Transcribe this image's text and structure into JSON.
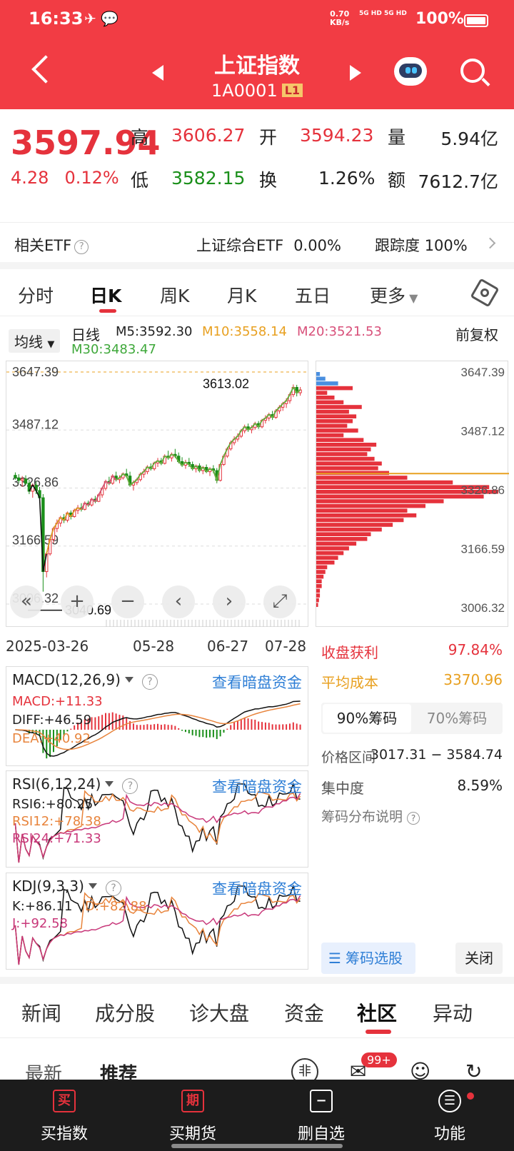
{
  "status_bar": {
    "time": "16:33",
    "net_speed": "0.70",
    "net_unit": "KB/s",
    "signal1": "5G HD",
    "signal2": "5G HD",
    "battery": "100%"
  },
  "header": {
    "title": "上证指数",
    "code": "1A0001",
    "level_badge": "L1"
  },
  "quote": {
    "price": "3597.94",
    "change": "4.28",
    "change_pct": "0.12%",
    "high_label": "高",
    "high": "3606.27",
    "open_label": "开",
    "open": "3594.23",
    "volume_label": "量",
    "volume": "5.94亿",
    "low_label": "低",
    "low": "3582.15",
    "turnover_label": "换",
    "turnover": "1.26%",
    "amount_label": "额",
    "amount": "7612.7亿"
  },
  "etf": {
    "label": "相关ETF",
    "name": "上证综合ETF",
    "change": "0.00%",
    "tracking_label": "跟踪度",
    "tracking": "100%"
  },
  "chart_tabs": [
    "分时",
    "日K",
    "周K",
    "月K",
    "五日",
    "更多"
  ],
  "active_chart_tab": "日K",
  "ma_bar": {
    "selector": "均线",
    "type": "日线",
    "ma5": "M5:3592.30",
    "ma10": "M10:3558.14",
    "ma20": "M20:3521.53",
    "ma30": "M30:3483.47",
    "adjust": "前复权"
  },
  "colors": {
    "brand": "#f23c44",
    "up": "#e5323c",
    "down": "#1a8f1a",
    "ma5": "#111111",
    "ma10": "#e8a020",
    "ma20": "#d8507a",
    "ma30": "#5cb83c",
    "link": "#2f7fd6"
  },
  "kline": {
    "y_ticks": [
      "3647.39",
      "3487.12",
      "3326.86",
      "3166.59",
      "3006.32"
    ],
    "max_label": "3613.02",
    "min_label": "3040.69",
    "dates": [
      "2025-03-26",
      "05-28",
      "06-27",
      "07-28"
    ]
  },
  "chart_data": {
    "type": "candlestick",
    "ylim": [
      3006.32,
      3647.39
    ],
    "y_ticks": [
      3647.39,
      3487.12,
      3326.86,
      3166.59,
      3006.32
    ],
    "x_labels": [
      "2025-03-26",
      "05-28",
      "06-27",
      "07-28"
    ],
    "ohlc": [
      [
        3362,
        3370,
        3350,
        3355
      ],
      [
        3355,
        3365,
        3340,
        3348
      ],
      [
        3348,
        3360,
        3330,
        3352
      ],
      [
        3352,
        3362,
        3335,
        3340
      ],
      [
        3340,
        3350,
        3310,
        3318
      ],
      [
        3318,
        3340,
        3300,
        3335
      ],
      [
        3335,
        3345,
        3310,
        3320
      ],
      [
        3320,
        3330,
        3290,
        3300
      ],
      [
        3300,
        3310,
        3040.69,
        3096
      ],
      [
        3096,
        3150,
        3080,
        3145
      ],
      [
        3145,
        3190,
        3140,
        3185
      ],
      [
        3185,
        3220,
        3175,
        3215
      ],
      [
        3215,
        3240,
        3205,
        3230
      ],
      [
        3230,
        3250,
        3220,
        3245
      ],
      [
        3245,
        3255,
        3230,
        3238
      ],
      [
        3238,
        3262,
        3232,
        3258
      ],
      [
        3258,
        3265,
        3240,
        3248
      ],
      [
        3248,
        3270,
        3245,
        3265
      ],
      [
        3265,
        3280,
        3255,
        3272
      ],
      [
        3272,
        3285,
        3262,
        3268
      ],
      [
        3268,
        3290,
        3265,
        3285
      ],
      [
        3285,
        3292,
        3275,
        3280
      ],
      [
        3280,
        3300,
        3276,
        3296
      ],
      [
        3296,
        3305,
        3285,
        3290
      ],
      [
        3290,
        3312,
        3288,
        3308
      ],
      [
        3308,
        3330,
        3300,
        3326
      ],
      [
        3326,
        3350,
        3320,
        3345
      ],
      [
        3345,
        3358,
        3335,
        3340
      ],
      [
        3340,
        3365,
        3336,
        3360
      ],
      [
        3360,
        3372,
        3345,
        3350
      ],
      [
        3350,
        3362,
        3340,
        3355
      ],
      [
        3355,
        3370,
        3350,
        3366
      ],
      [
        3366,
        3380,
        3355,
        3360
      ],
      [
        3360,
        3372,
        3330,
        3335
      ],
      [
        3335,
        3348,
        3320,
        3342
      ],
      [
        3342,
        3355,
        3335,
        3350
      ],
      [
        3350,
        3370,
        3345,
        3365
      ],
      [
        3365,
        3380,
        3355,
        3372
      ],
      [
        3372,
        3390,
        3365,
        3385
      ],
      [
        3385,
        3395,
        3375,
        3380
      ],
      [
        3380,
        3400,
        3375,
        3396
      ],
      [
        3396,
        3410,
        3385,
        3402
      ],
      [
        3402,
        3410,
        3390,
        3395
      ],
      [
        3395,
        3420,
        3392,
        3415
      ],
      [
        3415,
        3430,
        3405,
        3410
      ],
      [
        3410,
        3425,
        3400,
        3420
      ],
      [
        3420,
        3435,
        3410,
        3415
      ],
      [
        3415,
        3425,
        3395,
        3400
      ],
      [
        3400,
        3412,
        3385,
        3390
      ],
      [
        3390,
        3405,
        3380,
        3398
      ],
      [
        3398,
        3410,
        3385,
        3392
      ],
      [
        3392,
        3400,
        3375,
        3380
      ],
      [
        3380,
        3392,
        3370,
        3388
      ],
      [
        3388,
        3395,
        3370,
        3375
      ],
      [
        3375,
        3388,
        3365,
        3384
      ],
      [
        3384,
        3392,
        3368,
        3372
      ],
      [
        3372,
        3385,
        3360,
        3380
      ],
      [
        3380,
        3390,
        3368,
        3375
      ],
      [
        3375,
        3382,
        3340,
        3348
      ],
      [
        3348,
        3395,
        3345,
        3392
      ],
      [
        3392,
        3420,
        3388,
        3415
      ],
      [
        3415,
        3440,
        3410,
        3435
      ],
      [
        3435,
        3458,
        3430,
        3452
      ],
      [
        3452,
        3470,
        3445,
        3462
      ],
      [
        3462,
        3478,
        3455,
        3470
      ],
      [
        3470,
        3490,
        3465,
        3485
      ],
      [
        3485,
        3502,
        3478,
        3496
      ],
      [
        3496,
        3505,
        3482,
        3488
      ],
      [
        3488,
        3500,
        3478,
        3494
      ],
      [
        3494,
        3510,
        3488,
        3505
      ],
      [
        3505,
        3512,
        3490,
        3496
      ],
      [
        3496,
        3518,
        3492,
        3514
      ],
      [
        3514,
        3528,
        3505,
        3520
      ],
      [
        3520,
        3535,
        3512,
        3530
      ],
      [
        3530,
        3540,
        3515,
        3522
      ],
      [
        3522,
        3545,
        3518,
        3540
      ],
      [
        3540,
        3556,
        3532,
        3550
      ],
      [
        3550,
        3565,
        3540,
        3560
      ],
      [
        3560,
        3575,
        3548,
        3568
      ],
      [
        3568,
        3590,
        3560,
        3585
      ],
      [
        3585,
        3613.02,
        3578,
        3605
      ],
      [
        3605,
        3612,
        3580,
        3590
      ],
      [
        3590,
        3606,
        3582,
        3598
      ]
    ]
  },
  "volume_profile": {
    "y_ticks": [
      "3647.39",
      "3487.12",
      "3326.86",
      "3166.59",
      "3006.32"
    ],
    "bars": [
      0.02,
      0.05,
      0.12,
      0.2,
      0.06,
      0.1,
      0.15,
      0.25,
      0.18,
      0.22,
      0.2,
      0.17,
      0.23,
      0.15,
      0.26,
      0.33,
      0.3,
      0.28,
      0.32,
      0.36,
      0.34,
      0.4,
      0.5,
      0.75,
      0.95,
      1.0,
      0.92,
      0.7,
      0.6,
      0.5,
      0.55,
      0.48,
      0.42,
      0.36,
      0.3,
      0.28,
      0.22,
      0.18,
      0.15,
      0.12,
      0.1,
      0.06,
      0.05,
      0.04,
      0.03,
      0.03,
      0.02,
      0.02,
      0.015,
      0.01
    ]
  },
  "controls": {
    "first": "«",
    "zoom_in": "+",
    "zoom_out": "−",
    "prev": "‹",
    "next": "›",
    "fullscreen": "⤢"
  },
  "macd": {
    "name": "MACD(12,26,9)",
    "link": "查看暗盘资金",
    "macd": "MACD:+11.33",
    "diff": "DIFF:+46.59",
    "dea": "DEA:+40.92"
  },
  "rsi": {
    "name": "RSI(6,12,24)",
    "link": "查看暗盘资金",
    "rsi6": "RSI6:+80.25",
    "rsi12": "RSI12:+78.38",
    "rsi24": "RSI24:+71.33"
  },
  "kdj": {
    "name": "KDJ(9,3,3)",
    "link": "查看暗盘资金",
    "k": "K:+86.11",
    "d": "D:+82.88",
    "j": "J:+92.58"
  },
  "chip": {
    "profit_label": "收盘获利",
    "profit": "97.84%",
    "cost_label": "平均成本",
    "cost": "3370.96",
    "seg_on": "90%筹码",
    "seg_off": "70%筹码",
    "range_label": "价格区间",
    "range": "3017.31 − 3584.74",
    "conc_label": "集中度",
    "conc": "8.59%",
    "explain": "筹码分布说明",
    "select_btn": "筹码选股",
    "close_btn": "关闭"
  },
  "nav_tabs": [
    "新闻",
    "成分股",
    "诊大盘",
    "资金",
    "社区",
    "异动"
  ],
  "active_nav_tab": "社区",
  "sub_tabs": {
    "latest": "最新",
    "recommend": "推荐",
    "badge": "99+"
  },
  "bottom": [
    {
      "icon": "买",
      "label": "买指数"
    },
    {
      "icon": "期",
      "label": "买期货"
    },
    {
      "icon": "−",
      "label": "删自选"
    },
    {
      "icon": "☰",
      "label": "功能"
    }
  ]
}
